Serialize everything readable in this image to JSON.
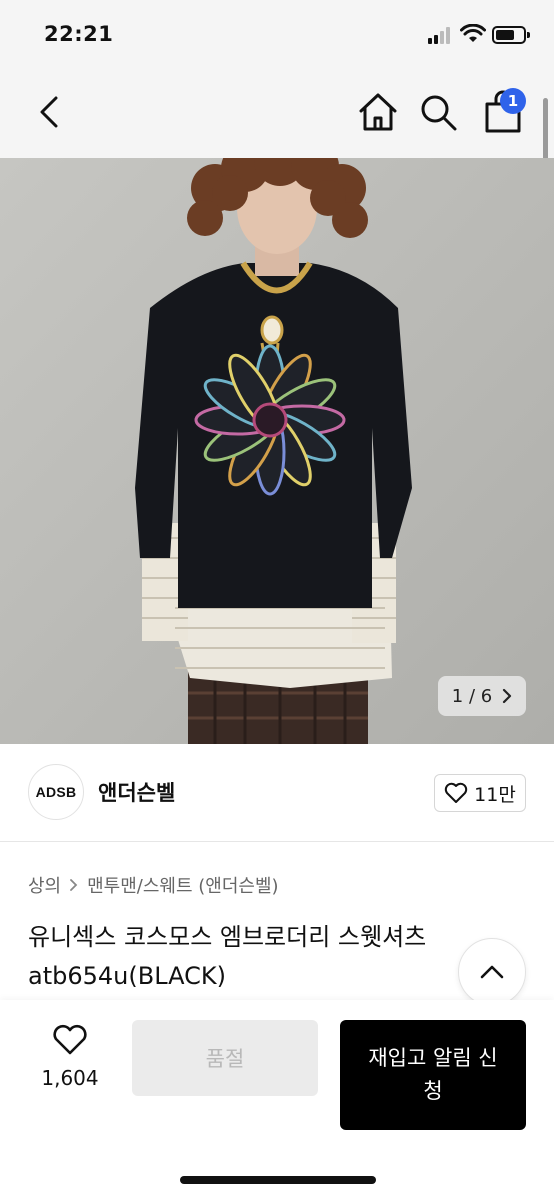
{
  "status_bar": {
    "time": "22:21"
  },
  "header": {
    "cart_count": "1"
  },
  "gallery": {
    "current": "1",
    "separator": "/",
    "total": "6"
  },
  "brand": {
    "logo_text": "ADSB",
    "name": "앤더슨벨",
    "like_count": "11만"
  },
  "breadcrumb": {
    "items": [
      "상의",
      "맨투맨/스웨트 (앤더슨벨)"
    ]
  },
  "product": {
    "title": "유니섹스 코스모스 엠브로더리 스웻셔츠 atb654u(BLACK)"
  },
  "bottom_bar": {
    "wish_count": "1,604",
    "soldout_label": "품절",
    "restock_label": "재입고 알림 신청"
  },
  "colors": {
    "accent_badge": "#2f63ea",
    "primary_button": "#000000",
    "disabled_button": "#ebebeb"
  }
}
